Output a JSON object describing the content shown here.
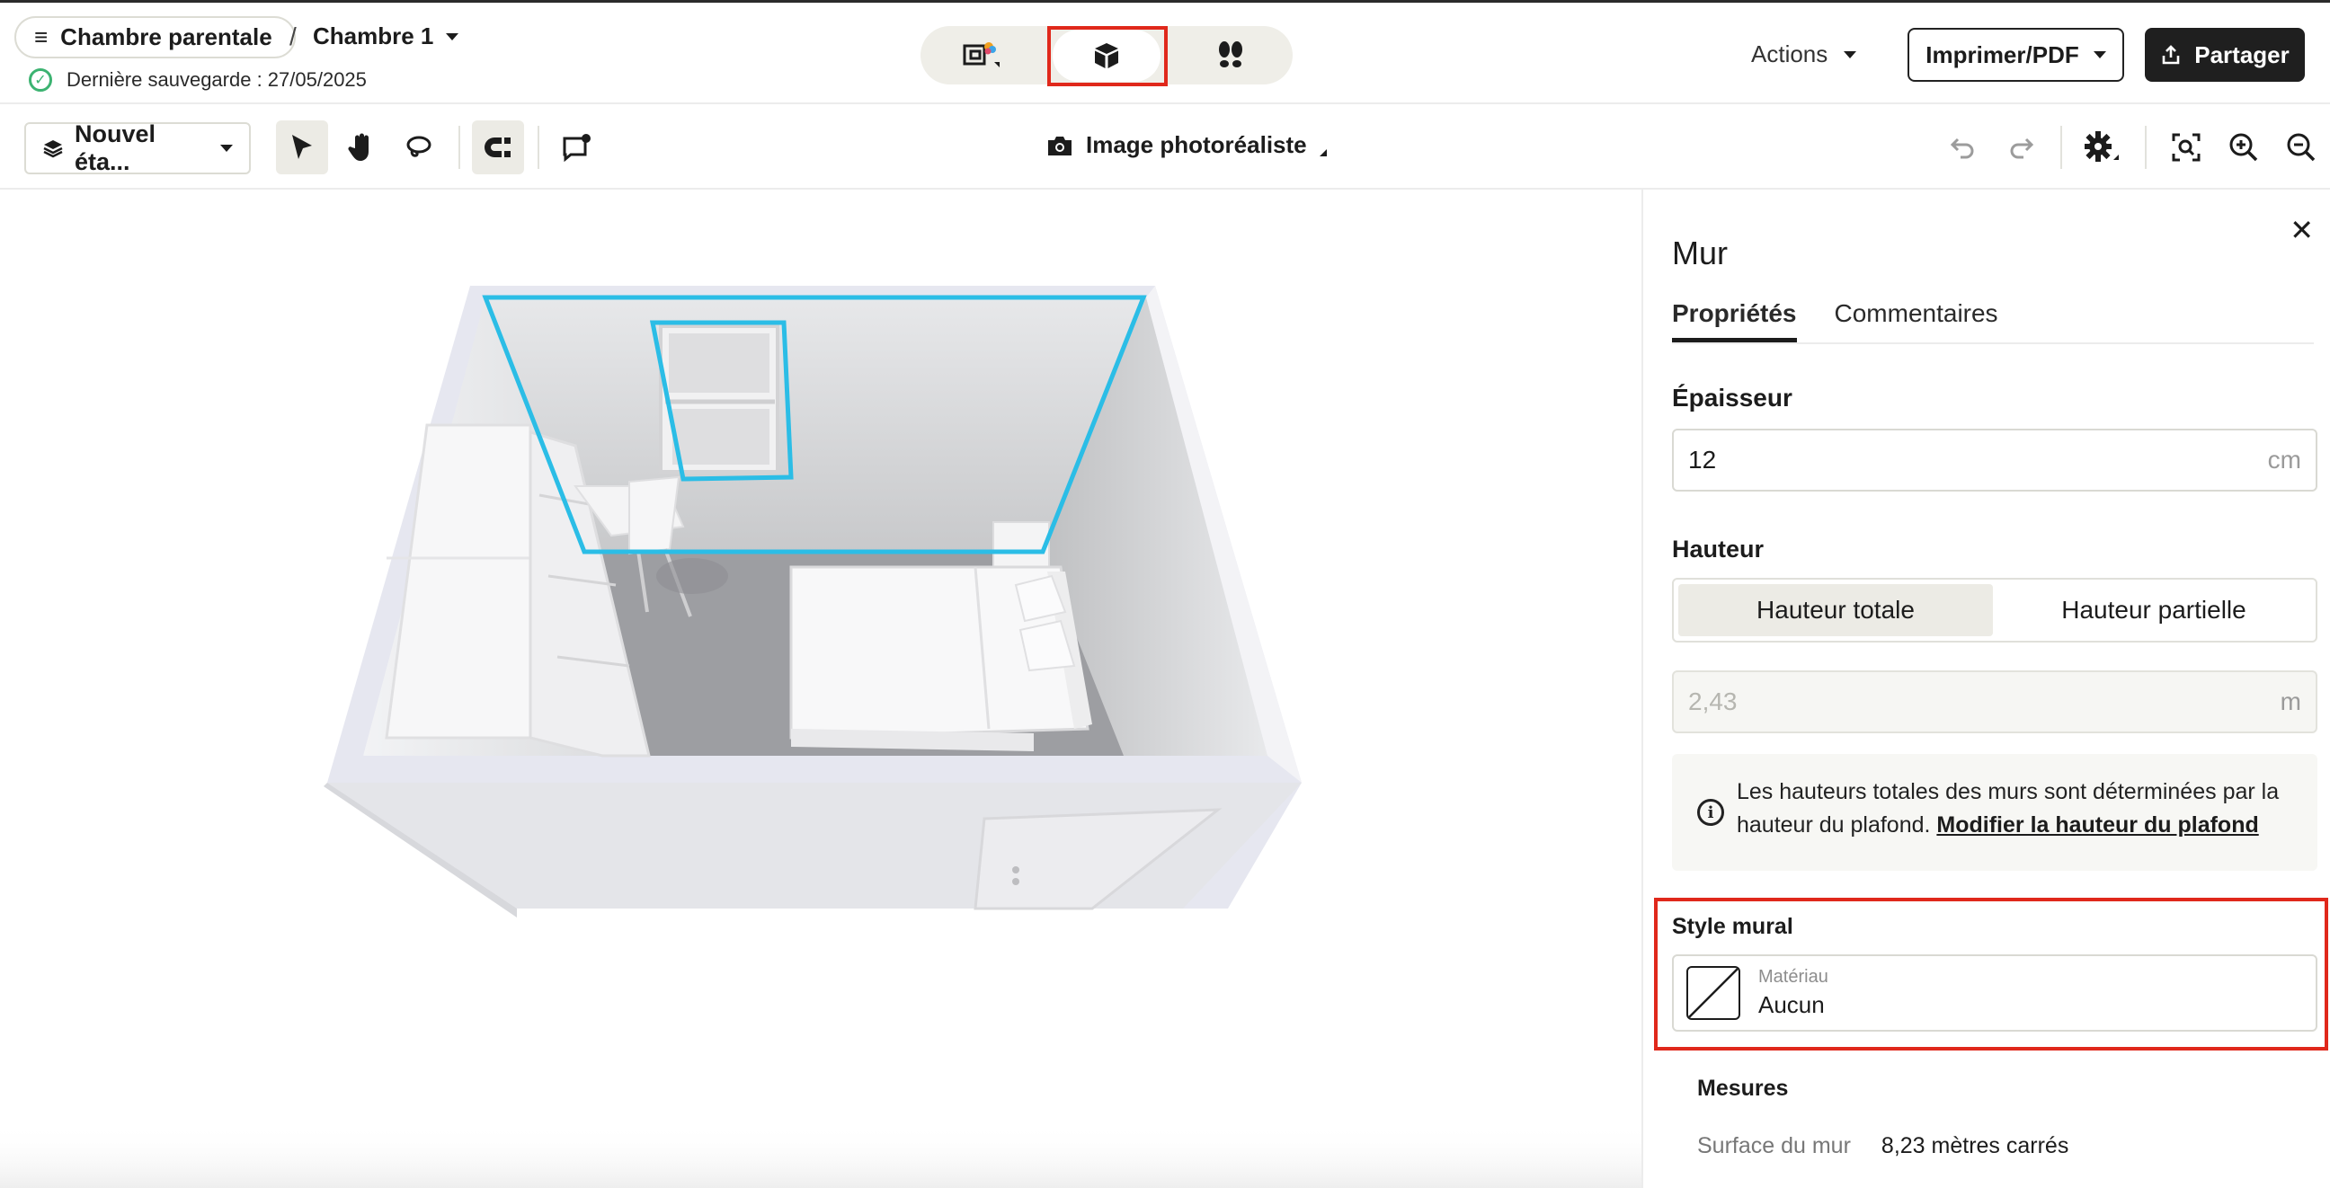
{
  "header": {
    "project_name": "Chambre parentale",
    "separator": "/",
    "room_name": "Chambre 1",
    "save_status": "Dernière sauvegarde : 27/05/2025",
    "view_modes": [
      "2d-plan-icon",
      "3d-box-icon",
      "walkthrough-footprints-icon"
    ],
    "active_view": "3d-box-icon",
    "actions_label": "Actions",
    "print_label": "Imprimer/PDF",
    "share_label": "Partager"
  },
  "toolbar": {
    "level_label": "Nouvel éta...",
    "photo_label": "Image photoréaliste"
  },
  "panel": {
    "title": "Mur",
    "tabs": [
      "Propriétés",
      "Commentaires"
    ],
    "active_tab": "Propriétés",
    "thickness": {
      "label": "Épaisseur",
      "value": "12",
      "unit": "cm"
    },
    "height": {
      "label": "Hauteur",
      "options": [
        "Hauteur totale",
        "Hauteur partielle"
      ],
      "active": "Hauteur totale",
      "value": "2,43",
      "unit": "m"
    },
    "info": {
      "text": "Les hauteurs totales des murs sont déterminées par la hauteur du plafond.",
      "link": "Modifier la hauteur du plafond"
    },
    "wall_style": {
      "label": "Style mural",
      "material_label": "Matériau",
      "material_value": "Aucun"
    },
    "measures": {
      "title": "Mesures",
      "wall_surface_label": "Surface du mur",
      "wall_surface_value": "8,23 mètres carrés"
    }
  },
  "colors": {
    "highlight_red": "#e0281b",
    "selection_cyan": "#2bbde6",
    "save_ok_green": "#3cb371",
    "dark_button": "#1f1f1f"
  }
}
